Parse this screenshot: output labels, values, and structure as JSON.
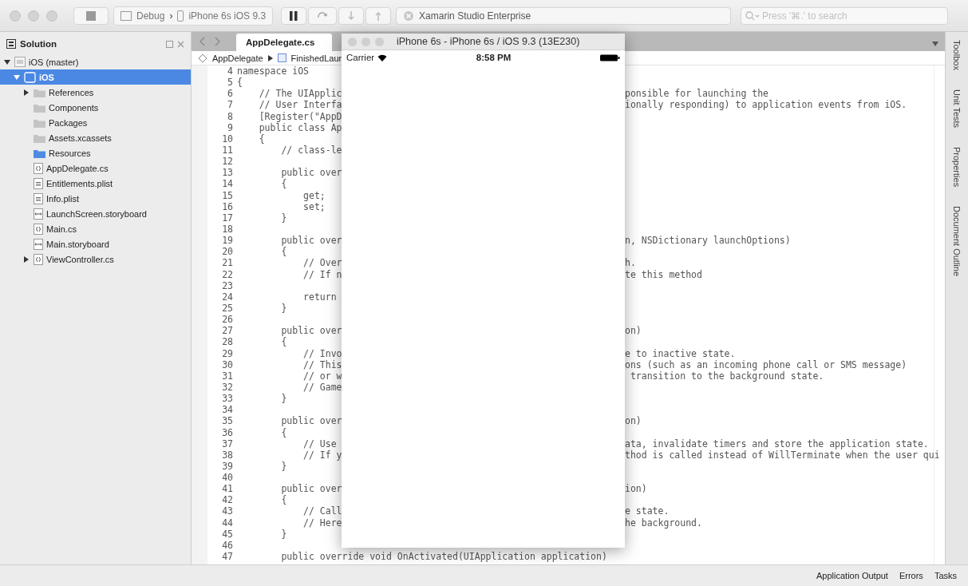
{
  "toolbar": {
    "config": "Debug",
    "separator": "›",
    "device": "iPhone 6s iOS 9.3",
    "status": "Xamarin Studio Enterprise",
    "search": {
      "placeholder": "Press '⌘.' to search"
    }
  },
  "solution": {
    "title": "Solution",
    "tree": [
      {
        "label": "iOS (master)",
        "kind": "solution",
        "expanded": true,
        "selected": false,
        "children": [
          {
            "label": "iOS",
            "kind": "project",
            "expanded": true,
            "selected": true,
            "children": [
              {
                "label": "References",
                "kind": "folder",
                "expanded": false,
                "selected": false
              },
              {
                "label": "Components",
                "kind": "folder",
                "selected": false
              },
              {
                "label": "Packages",
                "kind": "folder",
                "selected": false
              },
              {
                "label": "Assets.xcassets",
                "kind": "folder",
                "selected": false
              },
              {
                "label": "Resources",
                "kind": "folder-blue",
                "selected": false
              },
              {
                "label": "AppDelegate.cs",
                "kind": "code",
                "selected": false
              },
              {
                "label": "Entitlements.plist",
                "kind": "plist",
                "selected": false
              },
              {
                "label": "Info.plist",
                "kind": "plist",
                "selected": false
              },
              {
                "label": "LaunchScreen.storyboard",
                "kind": "storyboard",
                "selected": false
              },
              {
                "label": "Main.cs",
                "kind": "code",
                "selected": false
              },
              {
                "label": "Main.storyboard",
                "kind": "storyboard",
                "selected": false
              },
              {
                "label": "ViewController.cs",
                "kind": "code",
                "expanded": false,
                "selected": false
              }
            ]
          }
        ]
      }
    ]
  },
  "editor": {
    "tabs": [
      {
        "label": "AppDelegate.cs",
        "selected": true
      }
    ],
    "breadcrumb": [
      "AppDelegate",
      "FinishedLaun"
    ],
    "lines": [
      {
        "n": "4",
        "left": "namespace iOS"
      },
      {
        "n": "5",
        "left": "{"
      },
      {
        "n": "6",
        "left": "    // The UIApplic",
        "right": "ponsible for launching the"
      },
      {
        "n": "7",
        "left": "    // User Interfa",
        "right": "ionally responding) to application events from iOS."
      },
      {
        "n": "8",
        "left": "    [Register(\"AppD"
      },
      {
        "n": "9",
        "left": "    public class Ap"
      },
      {
        "n": "10",
        "left": "    {"
      },
      {
        "n": "11",
        "left": "        // class-le"
      },
      {
        "n": "12"
      },
      {
        "n": "13",
        "left": "        public over"
      },
      {
        "n": "14",
        "left": "        {"
      },
      {
        "n": "15",
        "left": "            get;"
      },
      {
        "n": "16",
        "left": "            set;"
      },
      {
        "n": "17",
        "left": "        }"
      },
      {
        "n": "18"
      },
      {
        "n": "19",
        "left": "        public over",
        "right": "n, NSDictionary launchOptions)"
      },
      {
        "n": "20",
        "left": "        {"
      },
      {
        "n": "21",
        "left": "            // Over",
        "right": "h."
      },
      {
        "n": "22",
        "left": "            // If n",
        "right": "te this method"
      },
      {
        "n": "23"
      },
      {
        "n": "24",
        "left": "            return"
      },
      {
        "n": "25",
        "left": "        }"
      },
      {
        "n": "26"
      },
      {
        "n": "27",
        "left": "        public over",
        "right": "on)"
      },
      {
        "n": "28",
        "left": "        {"
      },
      {
        "n": "29",
        "left": "            // Invo",
        "right": "e to inactive state."
      },
      {
        "n": "30",
        "left": "            // This",
        "right": "ons (such as an incoming phone call or SMS message)"
      },
      {
        "n": "31",
        "left": "            // or w",
        "right": " transition to the background state."
      },
      {
        "n": "32",
        "left": "            // Game"
      },
      {
        "n": "33",
        "left": "        }"
      },
      {
        "n": "34"
      },
      {
        "n": "35",
        "left": "        public over",
        "right": "on)"
      },
      {
        "n": "36",
        "left": "        {"
      },
      {
        "n": "37",
        "left": "            // Use",
        "right": "ata, invalidate timers and store the application state."
      },
      {
        "n": "38",
        "left": "            // If y",
        "right": "thod is called instead of WillTerminate when the user qui"
      },
      {
        "n": "39",
        "left": "        }"
      },
      {
        "n": "40"
      },
      {
        "n": "41",
        "left": "        public over",
        "right": "ion)"
      },
      {
        "n": "42",
        "left": "        {"
      },
      {
        "n": "43",
        "left": "            // Call",
        "right": "e state."
      },
      {
        "n": "44",
        "left": "            // Here",
        "right": "he background."
      },
      {
        "n": "45",
        "left": "        }"
      },
      {
        "n": "46"
      },
      {
        "n": "47",
        "left": "        public override void OnActivated(UIApplication application)"
      }
    ]
  },
  "side_tabs": [
    "Toolbox",
    "Unit Tests",
    "Properties",
    "Document Outline"
  ],
  "simulator": {
    "title": "iPhone 6s - iPhone 6s / iOS 9.3 (13E230)",
    "carrier": "Carrier",
    "time": "8:58 PM"
  },
  "status_bar": [
    "Application Output",
    "Errors",
    "Tasks"
  ]
}
